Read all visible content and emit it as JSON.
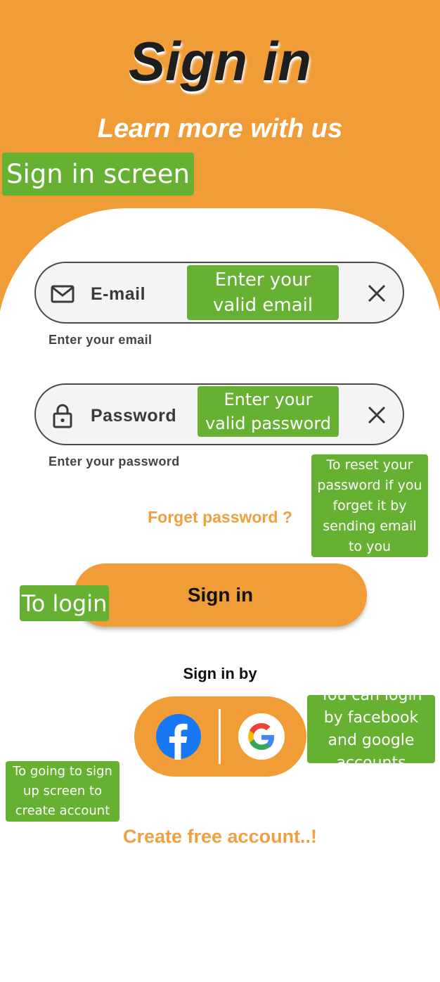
{
  "header": {
    "title": "Sign in",
    "subtitle": "Learn more with us"
  },
  "email_field": {
    "icon": "mail-icon",
    "label": "E-mail",
    "helper": "Enter your email",
    "clear_icon": "close-icon"
  },
  "password_field": {
    "icon": "lock-icon",
    "label": "Password",
    "helper": "Enter your password",
    "clear_icon": "close-icon"
  },
  "forgot_password": "Forget password ?",
  "sign_in_button": "Sign in",
  "social": {
    "label": "Sign in by",
    "facebook_icon": "facebook-icon",
    "google_icon": "google-icon"
  },
  "create_account": "Create free account..!",
  "annotations": {
    "screen": "Sign in screen",
    "email": "Enter your valid email",
    "password": "Enter your valid password",
    "forgot": "To reset your password  if you forget it by sending email to you",
    "login": "To login",
    "social": "You can login by facebook and google accounts",
    "signup": "To going to sign up screen to create account"
  },
  "colors": {
    "accent": "#F09D37",
    "annotation": "#66B032",
    "link": "#F0A040"
  }
}
